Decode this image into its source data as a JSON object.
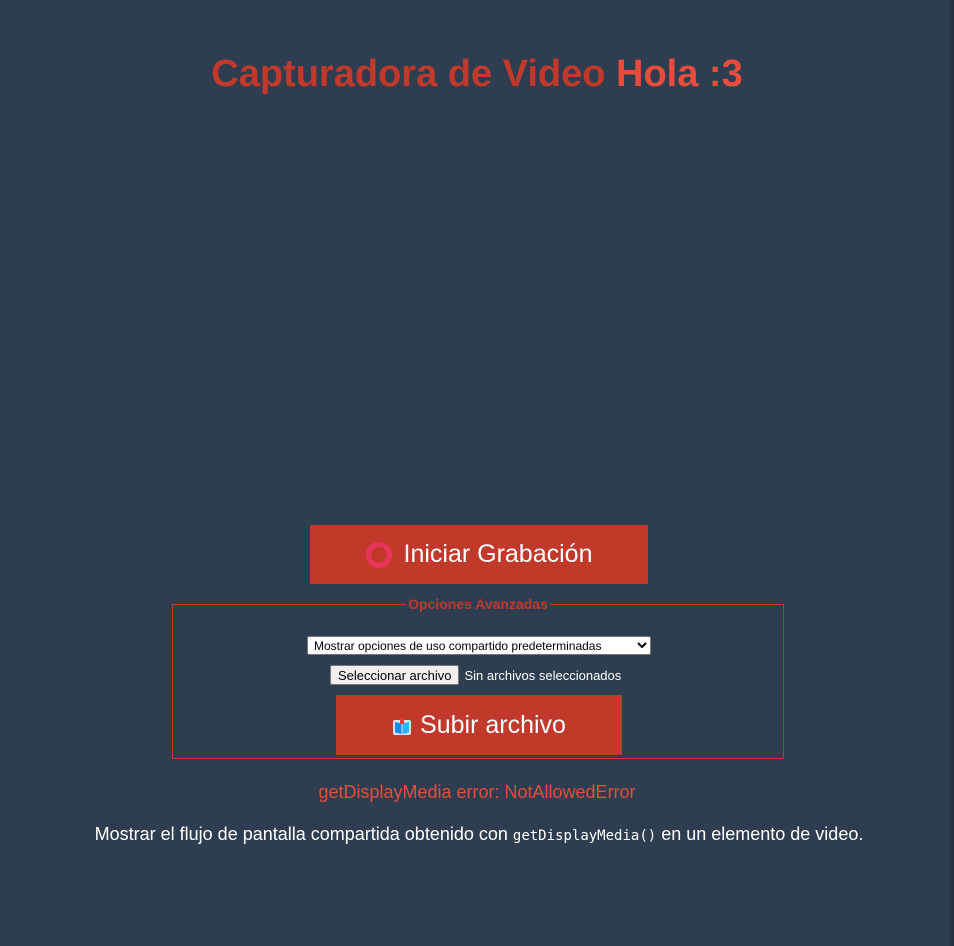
{
  "header": {
    "title_part1": "Capturadora de Video",
    "title_part2": "Hola :3"
  },
  "record_button": {
    "label": "Iniciar Grabación",
    "icon": "record-circle-icon"
  },
  "advanced_options": {
    "legend": "Opciones Avanzadas",
    "share_select": {
      "selected": "Mostrar opciones de uso compartido predeterminadas"
    },
    "file_input": {
      "button_label": "Seleccionar archivo",
      "status": "Sin archivos seleccionados"
    },
    "upload_button": {
      "label": "Subir archivo",
      "icon": "book-icon"
    }
  },
  "error": {
    "message": "getDisplayMedia error: NotAllowedError"
  },
  "description": {
    "before": "Mostrar el flujo de pantalla compartida obtenido con ",
    "code": "getDisplayMedia()",
    "after": " en un elemento de video."
  },
  "colors": {
    "background": "#2e3e50",
    "accent": "#c0392b",
    "error": "#e74c3c",
    "record_icon": "#e8335a"
  }
}
